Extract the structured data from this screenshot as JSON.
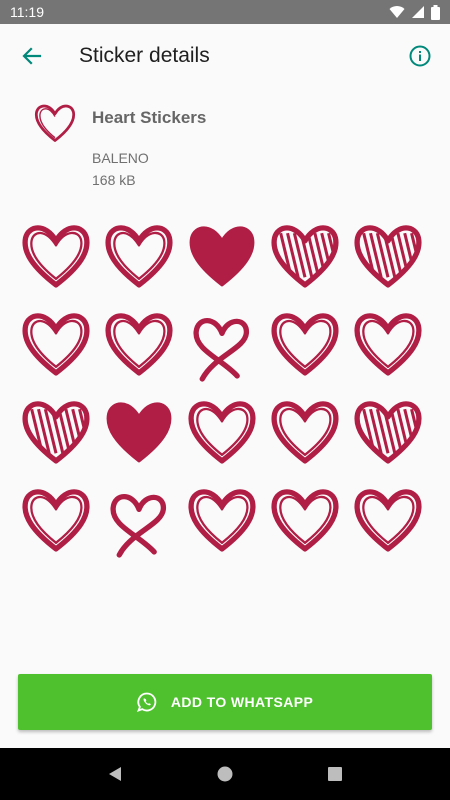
{
  "status_bar": {
    "time": "11:19",
    "icons": [
      "wifi-icon",
      "signal-icon",
      "battery-icon"
    ]
  },
  "app_bar": {
    "title": "Sticker details",
    "back_icon": "arrow-back-icon",
    "info_icon": "info-icon"
  },
  "pack": {
    "name": "Heart Stickers",
    "publisher": "BALENO",
    "size": "168 kB"
  },
  "stickers": [
    {
      "style": "outline"
    },
    {
      "style": "outline"
    },
    {
      "style": "filled"
    },
    {
      "style": "hatched"
    },
    {
      "style": "hatched"
    },
    {
      "style": "outline"
    },
    {
      "style": "outline"
    },
    {
      "style": "ribbon"
    },
    {
      "style": "outline"
    },
    {
      "style": "outline"
    },
    {
      "style": "hatched"
    },
    {
      "style": "filled"
    },
    {
      "style": "outline"
    },
    {
      "style": "outline"
    },
    {
      "style": "hatched"
    },
    {
      "style": "outline"
    },
    {
      "style": "ribbon"
    },
    {
      "style": "outline"
    },
    {
      "style": "outline"
    },
    {
      "style": "outline"
    }
  ],
  "add_button": {
    "label": "ADD TO WHATSAPP",
    "icon": "whatsapp-icon"
  },
  "nav_bar": {
    "icons": [
      "back-triangle-icon",
      "home-circle-icon",
      "recents-square-icon"
    ]
  },
  "colors": {
    "accent": "#00897b",
    "heart": "#b01e46",
    "button": "#4fc12e",
    "status_bar": "#757575"
  }
}
